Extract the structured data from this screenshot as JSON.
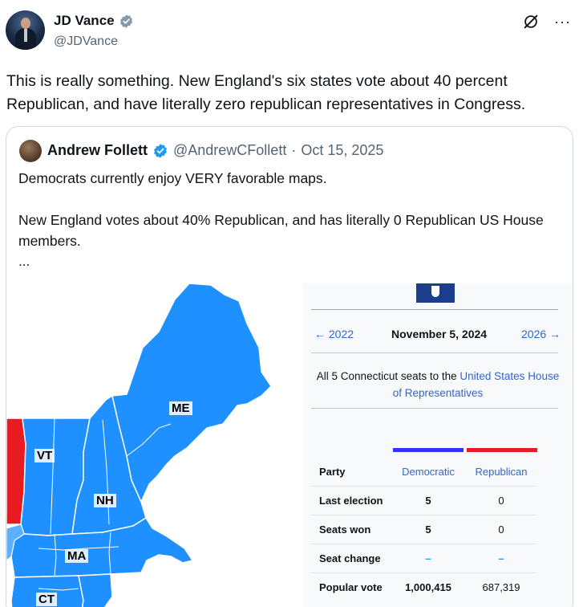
{
  "post": {
    "author_name": "JD Vance",
    "author_handle": "@JDVance",
    "text": "This is really something. New England's six states vote about 40 percent Republican, and have literally zero republican representatives in Congress."
  },
  "quote": {
    "author_name": "Andrew Follett",
    "author_handle": "@AndrewCFollett",
    "separator": "·",
    "date": "Oct 15, 2025",
    "text": "Democrats currently enjoy VERY favorable maps.\n\nNew England votes about 40% Republican, and has literally 0 Republican US House members.",
    "ellipsis": "..."
  },
  "map": {
    "labels": {
      "me": "ME",
      "vt": "VT",
      "nh": "NH",
      "ma": "MA",
      "ct": "CT"
    }
  },
  "infobox": {
    "nav_prev": "← 2022",
    "nav_date": "November 5, 2024",
    "nav_next": "2026 →",
    "summary_prefix": "All 5 Connecticut seats to the ",
    "summary_link": "United States House of Representatives",
    "rows": [
      {
        "label": "Party",
        "dem": "Democratic",
        "rep": "Republican"
      },
      {
        "label": "Last election",
        "dem": "5",
        "rep": "0"
      },
      {
        "label": "Seats won",
        "dem": "5",
        "rep": "0"
      },
      {
        "label": "Seat change",
        "dem": "–",
        "rep": "–"
      },
      {
        "label": "Popular vote",
        "dem": "1,000,415",
        "rep": "687,319"
      }
    ],
    "colors": {
      "democratic": "#3333ff",
      "republican": "#e81b23",
      "link": "#3366cc"
    }
  },
  "icons": [
    "verified-badge-icon",
    "grok-icon",
    "more-options-icon"
  ]
}
